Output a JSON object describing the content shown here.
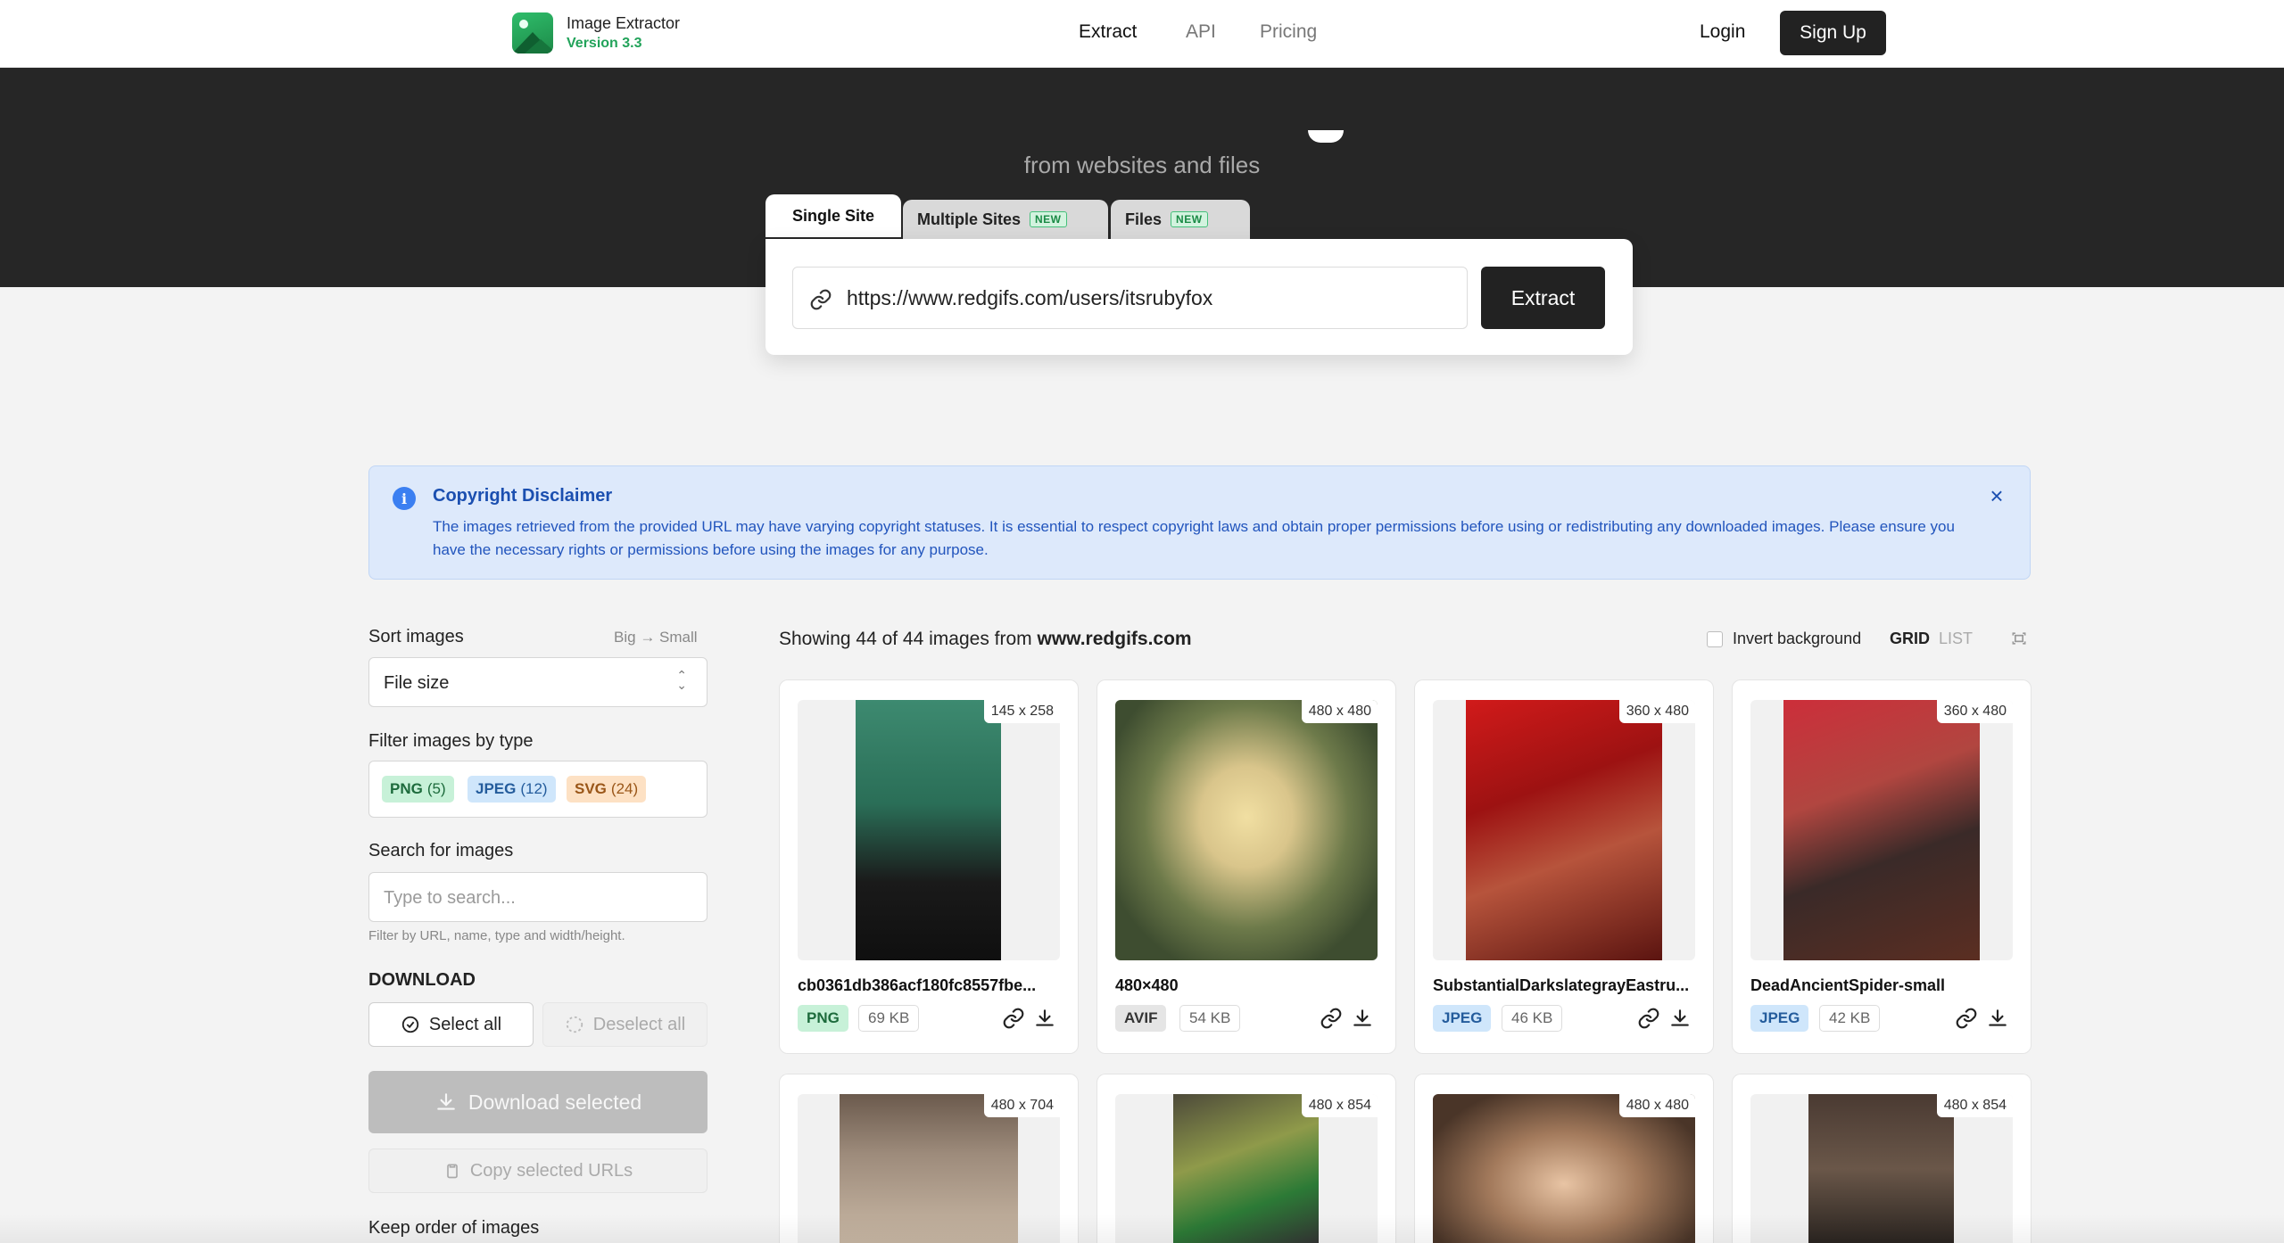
{
  "app": {
    "name": "Image Extractor",
    "version": "Version 3.3",
    "accent": "#22a35a"
  },
  "nav": {
    "items": [
      "Extract",
      "API",
      "Pricing"
    ],
    "login": "Login",
    "signup": "Sign Up"
  },
  "hero": {
    "subtitle": "from websites and files"
  },
  "extract": {
    "tabs": [
      {
        "label": "Single Site"
      },
      {
        "label": "Multiple Sites",
        "badge": "NEW"
      },
      {
        "label": "Files",
        "badge": "NEW"
      }
    ],
    "url_value": "https://www.redgifs.com/users/itsrubyfox",
    "button": "Extract"
  },
  "disclaimer": {
    "title": "Copyright Disclaimer",
    "text": "The images retrieved from the provided URL may have varying copyright statuses. It is essential to respect copyright laws and obtain proper permissions before using or redistributing any downloaded images. Please ensure you have the necessary rights or permissions before using the images for any purpose.",
    "color": "#dde9fb"
  },
  "sidebar": {
    "sort_label": "Sort images",
    "sort_hint_from": "Big",
    "sort_hint_to": "Small",
    "sort_value": "File size",
    "filter_label": "Filter images by type",
    "filters": [
      {
        "type": "PNG",
        "count": "(5)"
      },
      {
        "type": "JPEG",
        "count": "(12)"
      },
      {
        "type": "SVG",
        "count": "(24)"
      }
    ],
    "search_label": "Search for images",
    "search_placeholder": "Type to search...",
    "search_hint": "Filter by URL, name, type and width/height.",
    "download_title": "DOWNLOAD",
    "select_all": "Select all",
    "deselect_all": "Deselect all",
    "download_selected": "Download selected",
    "copy_urls": "Copy selected URLs",
    "keep_order": "Keep order of images"
  },
  "results": {
    "showing_prefix": "Showing 44 of 44 images from",
    "domain": "www.redgifs.com",
    "invert_label": "Invert background",
    "view_grid": "GRID",
    "view_list": "LIST"
  },
  "cards": [
    {
      "dims": "145 x 258",
      "name": "cb0361db386acf180fc8557fbe...",
      "type": "PNG",
      "size": "69 KB"
    },
    {
      "dims": "480 x 480",
      "name": "480×480",
      "type": "AVIF",
      "size": "54 KB"
    },
    {
      "dims": "360 x 480",
      "name": "SubstantialDarkslategrayEastru...",
      "type": "JPEG",
      "size": "46 KB"
    },
    {
      "dims": "360 x 480",
      "name": "DeadAncientSpider-small",
      "type": "JPEG",
      "size": "42 KB"
    },
    {
      "dims": "480 x 704"
    },
    {
      "dims": "480 x 854"
    },
    {
      "dims": "480 x 480"
    },
    {
      "dims": "480 x 854"
    }
  ]
}
